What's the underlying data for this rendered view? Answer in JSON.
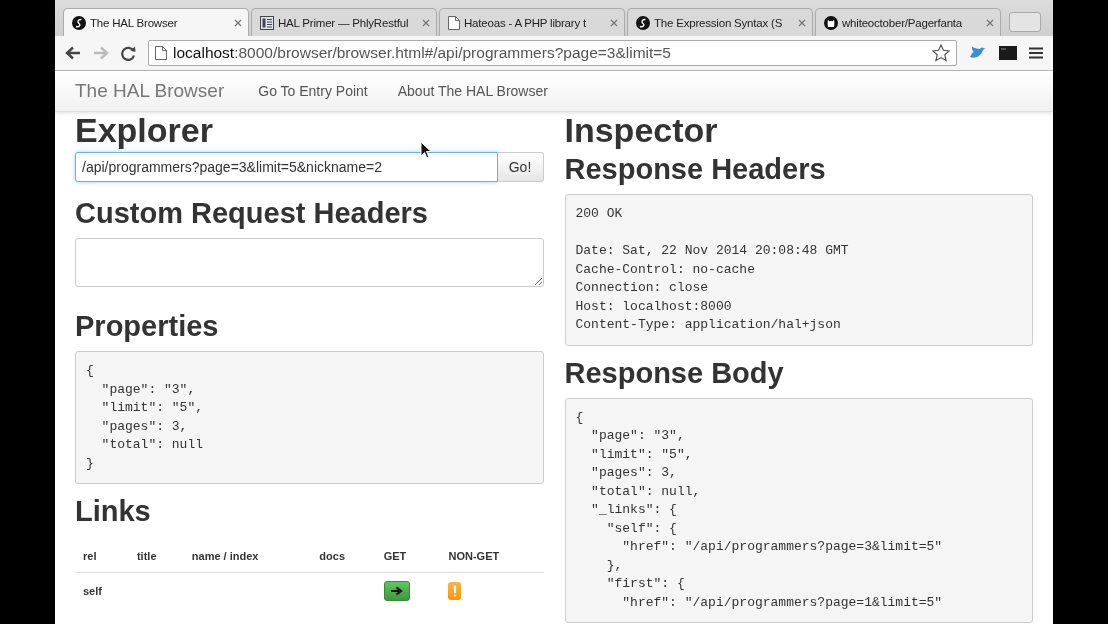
{
  "browser": {
    "tabs": [
      {
        "title": "The HAL Browser",
        "selected": true,
        "kind": "circle-logo"
      },
      {
        "title": "HAL Primer — PhlyRestful",
        "selected": false,
        "kind": "grid-doc"
      },
      {
        "title": "Hateoas - A PHP library t",
        "selected": false,
        "kind": "page"
      },
      {
        "title": "The Expression Syntax (S",
        "selected": false,
        "kind": "circle-logo"
      },
      {
        "title": "whiteoctober/Pagerfanta",
        "selected": false,
        "kind": "cat"
      }
    ],
    "address": {
      "host": "localhost",
      "rest": ":8000/browser/browser.html#/api/programmers?page=3&limit=5"
    }
  },
  "navbar": {
    "brand": "The HAL Browser",
    "links": [
      "Go To Entry Point",
      "About The HAL Browser"
    ]
  },
  "explorer": {
    "heading": "Explorer",
    "url_field": {
      "value": "/api/programmers?page=3&limit=5&nickname=2"
    },
    "go_button": "Go!",
    "custom_headers_heading": "Custom Request Headers",
    "properties": {
      "heading": "Properties",
      "body": "{\n  \"page\": \"3\",\n  \"limit\": \"5\",\n  \"pages\": 3,\n  \"total\": null\n}"
    },
    "links": {
      "heading": "Links",
      "columns": [
        "rel",
        "title",
        "name / index",
        "docs",
        "GET",
        "NON-GET"
      ],
      "rows": [
        {
          "rel": "self"
        }
      ]
    }
  },
  "inspector": {
    "heading": "Inspector",
    "response_headers": {
      "heading": "Response Headers",
      "body": "200 OK\n\nDate: Sat, 22 Nov 2014 20:08:48 GMT\nCache-Control: no-cache\nConnection: close\nHost: localhost:8000\nContent-Type: application/hal+json"
    },
    "response_body": {
      "heading": "Response Body",
      "body": "{\n  \"page\": \"3\",\n  \"limit\": \"5\",\n  \"pages\": 3,\n  \"total\": null,\n  \"_links\": {\n    \"self\": {\n      \"href\": \"/api/programmers?page=3&limit=5\"\n    },\n    \"first\": {\n      \"href\": \"/api/programmers?page=1&limit=5\""
    }
  }
}
